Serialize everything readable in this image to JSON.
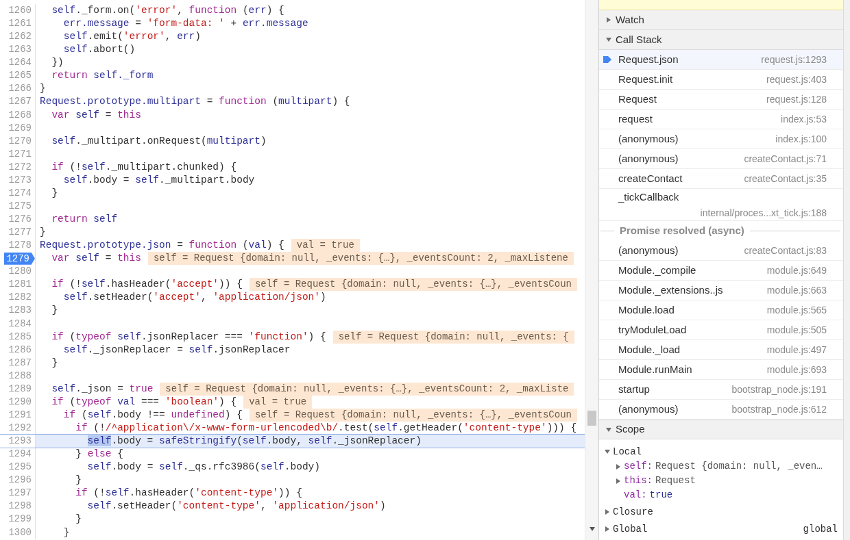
{
  "editor": {
    "lines": [
      {
        "number": "1260",
        "tokens": [
          {
            "kind": "i",
            "text": "  self"
          },
          {
            "kind": "p",
            "text": "._form.on("
          },
          {
            "kind": "s",
            "text": "'error'"
          },
          {
            "kind": "p",
            "text": ", "
          },
          {
            "kind": "k",
            "text": "function"
          },
          {
            "kind": "p",
            "text": " ("
          },
          {
            "kind": "i",
            "text": "err"
          },
          {
            "kind": "p",
            "text": ") {"
          }
        ],
        "breakpoint": false,
        "current": false
      },
      {
        "number": "1261",
        "tokens": [
          {
            "kind": "i",
            "text": "    err.message"
          },
          {
            "kind": "p",
            "text": " = "
          },
          {
            "kind": "s",
            "text": "'form-data: '"
          },
          {
            "kind": "p",
            "text": " + "
          },
          {
            "kind": "i",
            "text": "err.message"
          }
        ],
        "breakpoint": false,
        "current": false
      },
      {
        "number": "1262",
        "tokens": [
          {
            "kind": "i",
            "text": "    self"
          },
          {
            "kind": "p",
            "text": ".emit("
          },
          {
            "kind": "s",
            "text": "'error'"
          },
          {
            "kind": "p",
            "text": ", "
          },
          {
            "kind": "i",
            "text": "err"
          },
          {
            "kind": "p",
            "text": ")"
          }
        ],
        "breakpoint": false,
        "current": false
      },
      {
        "number": "1263",
        "tokens": [
          {
            "kind": "i",
            "text": "    self"
          },
          {
            "kind": "p",
            "text": ".abort()"
          }
        ],
        "breakpoint": false,
        "current": false
      },
      {
        "number": "1264",
        "tokens": [
          {
            "kind": "p",
            "text": "  })"
          }
        ],
        "breakpoint": false,
        "current": false
      },
      {
        "number": "1265",
        "tokens": [
          {
            "kind": "k",
            "text": "  return "
          },
          {
            "kind": "i",
            "text": "self._form"
          }
        ],
        "breakpoint": false,
        "current": false
      },
      {
        "number": "1266",
        "tokens": [
          {
            "kind": "p",
            "text": "}"
          }
        ],
        "breakpoint": false,
        "current": false
      },
      {
        "number": "1267",
        "tokens": [
          {
            "kind": "i",
            "text": "Request.prototype.multipart"
          },
          {
            "kind": "p",
            "text": " = "
          },
          {
            "kind": "k",
            "text": "function"
          },
          {
            "kind": "p",
            "text": " ("
          },
          {
            "kind": "i",
            "text": "multipart"
          },
          {
            "kind": "p",
            "text": ") {"
          }
        ],
        "breakpoint": false,
        "current": false
      },
      {
        "number": "1268",
        "tokens": [
          {
            "kind": "k",
            "text": "  var "
          },
          {
            "kind": "i",
            "text": "self"
          },
          {
            "kind": "p",
            "text": " = "
          },
          {
            "kind": "k",
            "text": "this"
          }
        ],
        "breakpoint": false,
        "current": false
      },
      {
        "number": "1269",
        "breakpoint": false,
        "current": false
      },
      {
        "number": "1270",
        "tokens": [
          {
            "kind": "i",
            "text": "  self"
          },
          {
            "kind": "p",
            "text": "._multipart.onRequest("
          },
          {
            "kind": "i",
            "text": "multipart"
          },
          {
            "kind": "p",
            "text": ")"
          }
        ],
        "breakpoint": false,
        "current": false
      },
      {
        "number": "1271",
        "breakpoint": false,
        "current": false
      },
      {
        "number": "1272",
        "tokens": [
          {
            "kind": "k",
            "text": "  if"
          },
          {
            "kind": "p",
            "text": " (!"
          },
          {
            "kind": "i",
            "text": "self"
          },
          {
            "kind": "p",
            "text": "._multipart.chunked) {"
          }
        ],
        "breakpoint": false,
        "current": false
      },
      {
        "number": "1273",
        "tokens": [
          {
            "kind": "i",
            "text": "    self"
          },
          {
            "kind": "p",
            "text": ".body = "
          },
          {
            "kind": "i",
            "text": "self"
          },
          {
            "kind": "p",
            "text": "._multipart.body"
          }
        ],
        "breakpoint": false,
        "current": false
      },
      {
        "number": "1274",
        "tokens": [
          {
            "kind": "p",
            "text": "  }"
          }
        ],
        "breakpoint": false,
        "current": false
      },
      {
        "number": "1275",
        "breakpoint": false,
        "current": false
      },
      {
        "number": "1276",
        "tokens": [
          {
            "kind": "k",
            "text": "  return "
          },
          {
            "kind": "i",
            "text": "self"
          }
        ],
        "breakpoint": false,
        "current": false
      },
      {
        "number": "1277",
        "tokens": [
          {
            "kind": "p",
            "text": "}"
          }
        ],
        "breakpoint": false,
        "current": false
      },
      {
        "number": "1278",
        "tokens": [
          {
            "kind": "i",
            "text": "Request.prototype.json"
          },
          {
            "kind": "p",
            "text": " = "
          },
          {
            "kind": "k",
            "text": "function"
          },
          {
            "kind": "p",
            "text": " ("
          },
          {
            "kind": "i",
            "text": "val"
          },
          {
            "kind": "p",
            "text": ") {"
          }
        ],
        "inline_value": "val = true",
        "breakpoint": false,
        "current": false
      },
      {
        "number": "1279",
        "tokens": [
          {
            "kind": "k",
            "text": "  var "
          },
          {
            "kind": "i",
            "text": "self"
          },
          {
            "kind": "p",
            "text": " = "
          },
          {
            "kind": "k",
            "text": "this"
          }
        ],
        "inline_value": "self = Request {domain: null, _events: {…}, _eventsCount: 2, _maxListene",
        "breakpoint": true,
        "current": false
      },
      {
        "number": "1280",
        "breakpoint": false,
        "current": false
      },
      {
        "number": "1281",
        "tokens": [
          {
            "kind": "k",
            "text": "  if"
          },
          {
            "kind": "p",
            "text": " (!"
          },
          {
            "kind": "i",
            "text": "self"
          },
          {
            "kind": "p",
            "text": ".hasHeader("
          },
          {
            "kind": "s",
            "text": "'accept'"
          },
          {
            "kind": "p",
            "text": ")) {"
          }
        ],
        "inline_value": "self = Request {domain: null, _events: {…}, _eventsCoun",
        "breakpoint": false,
        "current": false
      },
      {
        "number": "1282",
        "tokens": [
          {
            "kind": "i",
            "text": "    self"
          },
          {
            "kind": "p",
            "text": ".setHeader("
          },
          {
            "kind": "s",
            "text": "'accept'"
          },
          {
            "kind": "p",
            "text": ", "
          },
          {
            "kind": "s",
            "text": "'application/json'"
          },
          {
            "kind": "p",
            "text": ")"
          }
        ],
        "breakpoint": false,
        "current": false
      },
      {
        "number": "1283",
        "tokens": [
          {
            "kind": "p",
            "text": "  }"
          }
        ],
        "breakpoint": false,
        "current": false
      },
      {
        "number": "1284",
        "breakpoint": false,
        "current": false
      },
      {
        "number": "1285",
        "tokens": [
          {
            "kind": "k",
            "text": "  if"
          },
          {
            "kind": "p",
            "text": " ("
          },
          {
            "kind": "k",
            "text": "typeof "
          },
          {
            "kind": "i",
            "text": "self"
          },
          {
            "kind": "p",
            "text": ".jsonReplacer === "
          },
          {
            "kind": "s",
            "text": "'function'"
          },
          {
            "kind": "p",
            "text": ") {"
          }
        ],
        "inline_value": "self = Request {domain: null, _events: {",
        "breakpoint": false,
        "current": false
      },
      {
        "number": "1286",
        "tokens": [
          {
            "kind": "i",
            "text": "    self"
          },
          {
            "kind": "p",
            "text": "._jsonReplacer = "
          },
          {
            "kind": "i",
            "text": "self"
          },
          {
            "kind": "p",
            "text": ".jsonReplacer"
          }
        ],
        "breakpoint": false,
        "current": false
      },
      {
        "number": "1287",
        "tokens": [
          {
            "kind": "p",
            "text": "  }"
          }
        ],
        "breakpoint": false,
        "current": false
      },
      {
        "number": "1288",
        "breakpoint": false,
        "current": false
      },
      {
        "number": "1289",
        "tokens": [
          {
            "kind": "i",
            "text": "  self"
          },
          {
            "kind": "p",
            "text": "._json = "
          },
          {
            "kind": "k",
            "text": "true"
          }
        ],
        "inline_value": "self = Request {domain: null, _events: {…}, _eventsCount: 2, _maxListe",
        "breakpoint": false,
        "current": false
      },
      {
        "number": "1290",
        "tokens": [
          {
            "kind": "k",
            "text": "  if"
          },
          {
            "kind": "p",
            "text": " ("
          },
          {
            "kind": "k",
            "text": "typeof "
          },
          {
            "kind": "i",
            "text": "val"
          },
          {
            "kind": "p",
            "text": " === "
          },
          {
            "kind": "s",
            "text": "'boolean'"
          },
          {
            "kind": "p",
            "text": ") {"
          }
        ],
        "inline_value": "val = true",
        "breakpoint": false,
        "current": false
      },
      {
        "number": "1291",
        "tokens": [
          {
            "kind": "k",
            "text": "    if"
          },
          {
            "kind": "p",
            "text": " ("
          },
          {
            "kind": "i",
            "text": "self"
          },
          {
            "kind": "p",
            "text": ".body !== "
          },
          {
            "kind": "k",
            "text": "undefined"
          },
          {
            "kind": "p",
            "text": ") {"
          }
        ],
        "inline_value": "self = Request {domain: null, _events: {…}, _eventsCoun",
        "breakpoint": false,
        "current": false
      },
      {
        "number": "1292",
        "tokens": [
          {
            "kind": "k",
            "text": "      if"
          },
          {
            "kind": "p",
            "text": " (!"
          },
          {
            "kind": "s",
            "text": "/^application\\/x-www-form-urlencoded\\b/"
          },
          {
            "kind": "p",
            "text": ".test("
          },
          {
            "kind": "i",
            "text": "self"
          },
          {
            "kind": "p",
            "text": ".getHeader("
          },
          {
            "kind": "s",
            "text": "'content-type'"
          },
          {
            "kind": "p",
            "text": "))) {"
          }
        ],
        "breakpoint": false,
        "current": false
      },
      {
        "number": "1293",
        "tokens": [
          {
            "kind": "sel",
            "text": "self"
          },
          {
            "kind": "p",
            "text": ".body = "
          },
          {
            "kind": "i",
            "text": "safeStringify"
          },
          {
            "kind": "p",
            "text": "("
          },
          {
            "kind": "i",
            "text": "self"
          },
          {
            "kind": "p",
            "text": ".body, "
          },
          {
            "kind": "i",
            "text": "self"
          },
          {
            "kind": "p",
            "text": "._jsonReplacer)"
          }
        ],
        "breakpoint": false,
        "current": true
      },
      {
        "number": "1294",
        "tokens": [
          {
            "kind": "p",
            "text": "      } "
          },
          {
            "kind": "k",
            "text": "else"
          },
          {
            "kind": "p",
            "text": " {"
          }
        ],
        "breakpoint": false,
        "current": false
      },
      {
        "number": "1295",
        "tokens": [
          {
            "kind": "i",
            "text": "        self"
          },
          {
            "kind": "p",
            "text": ".body = "
          },
          {
            "kind": "i",
            "text": "self"
          },
          {
            "kind": "p",
            "text": "._qs.rfc3986("
          },
          {
            "kind": "i",
            "text": "self"
          },
          {
            "kind": "p",
            "text": ".body)"
          }
        ],
        "breakpoint": false,
        "current": false
      },
      {
        "number": "1296",
        "tokens": [
          {
            "kind": "p",
            "text": "      }"
          }
        ],
        "breakpoint": false,
        "current": false
      },
      {
        "number": "1297",
        "tokens": [
          {
            "kind": "k",
            "text": "      if"
          },
          {
            "kind": "p",
            "text": " (!"
          },
          {
            "kind": "i",
            "text": "self"
          },
          {
            "kind": "p",
            "text": ".hasHeader("
          },
          {
            "kind": "s",
            "text": "'content-type'"
          },
          {
            "kind": "p",
            "text": ")) {"
          }
        ],
        "breakpoint": false,
        "current": false
      },
      {
        "number": "1298",
        "tokens": [
          {
            "kind": "i",
            "text": "        self"
          },
          {
            "kind": "p",
            "text": ".setHeader("
          },
          {
            "kind": "s",
            "text": "'content-type'"
          },
          {
            "kind": "p",
            "text": ", "
          },
          {
            "kind": "s",
            "text": "'application/json'"
          },
          {
            "kind": "p",
            "text": ")"
          }
        ],
        "breakpoint": false,
        "current": false
      },
      {
        "number": "1299",
        "tokens": [
          {
            "kind": "p",
            "text": "      }"
          }
        ],
        "breakpoint": false,
        "current": false
      },
      {
        "number": "1300",
        "tokens": [
          {
            "kind": "p",
            "text": "    }"
          }
        ],
        "breakpoint": false,
        "current": false
      }
    ]
  },
  "sidebar": {
    "watch": {
      "title": "Watch",
      "expanded": false
    },
    "call_stack": {
      "title": "Call Stack",
      "expanded": true,
      "frames": [
        {
          "kind": "frame",
          "name": "Request.json",
          "location": "request.js:1293",
          "selected": true
        },
        {
          "kind": "frame",
          "name": "Request.init",
          "location": "request.js:403",
          "selected": false
        },
        {
          "kind": "frame",
          "name": "Request",
          "location": "request.js:128",
          "selected": false
        },
        {
          "kind": "frame",
          "name": "request",
          "location": "index.js:53",
          "selected": false
        },
        {
          "kind": "frame",
          "name": "(anonymous)",
          "location": "index.js:100",
          "selected": false
        },
        {
          "kind": "frame",
          "name": "(anonymous)",
          "location": "createContact.js:71",
          "selected": false
        },
        {
          "kind": "frame",
          "name": "createContact",
          "location": "createContact.js:35",
          "selected": false
        },
        {
          "kind": "frame_wrapped",
          "name": "_tickCallback",
          "location": "internal/proces...xt_tick.js:188",
          "selected": false
        },
        {
          "kind": "async",
          "name": "Promise resolved (async)"
        },
        {
          "kind": "frame",
          "name": "(anonymous)",
          "location": "createContact.js:83",
          "selected": false
        },
        {
          "kind": "frame",
          "name": "Module._compile",
          "location": "module.js:649",
          "selected": false
        },
        {
          "kind": "frame",
          "name": "Module._extensions..js",
          "location": "module.js:663",
          "selected": false
        },
        {
          "kind": "frame",
          "name": "Module.load",
          "location": "module.js:565",
          "selected": false
        },
        {
          "kind": "frame",
          "name": "tryModuleLoad",
          "location": "module.js:505",
          "selected": false
        },
        {
          "kind": "frame",
          "name": "Module._load",
          "location": "module.js:497",
          "selected": false
        },
        {
          "kind": "frame",
          "name": "Module.runMain",
          "location": "module.js:693",
          "selected": false
        },
        {
          "kind": "frame",
          "name": "startup",
          "location": "bootstrap_node.js:191",
          "selected": false
        },
        {
          "kind": "frame",
          "name": "(anonymous)",
          "location": "bootstrap_node.js:612",
          "selected": false
        }
      ]
    },
    "scope": {
      "title": "Scope",
      "expanded": true,
      "groups": [
        {
          "name": "Local",
          "expanded": true,
          "properties": [
            {
              "name": "self:",
              "value": "Request {domain: null, _even…",
              "expandable": true
            },
            {
              "name": "this:",
              "value": "Request",
              "expandable": true
            },
            {
              "name": "val:",
              "value": "true",
              "expandable": false
            }
          ]
        },
        {
          "name": "Closure",
          "expanded": false
        },
        {
          "name": "Global",
          "expanded": false,
          "value": "global"
        }
      ]
    }
  }
}
